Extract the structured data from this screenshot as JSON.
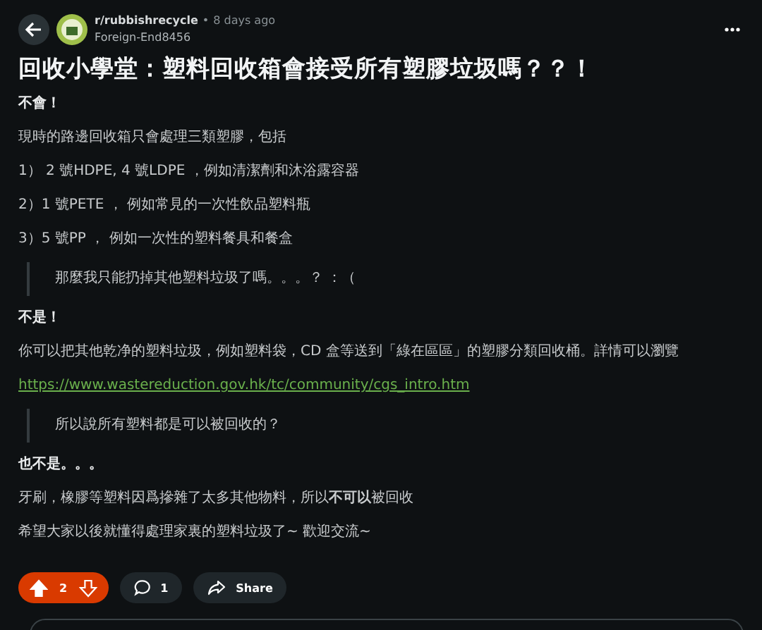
{
  "post": {
    "subreddit": "r/rubbishrecycle",
    "separator": "•",
    "time": "8 days ago",
    "author": "Foreign-End8456",
    "title": "回收小學堂：塑料回收箱會接受所有塑膠垃圾嗎？？！"
  },
  "body": [
    {
      "kind": "bold",
      "text": "不會！"
    },
    {
      "kind": "text",
      "text": "現時的路邊回收箱只會處理三類塑膠，包括"
    },
    {
      "kind": "text",
      "text": "1） 2 號HDPE, 4 號LDPE ，例如清潔劑和沐浴露容器"
    },
    {
      "kind": "text",
      "text": "2）1 號PETE ， 例如常見的一次性飲品塑料瓶"
    },
    {
      "kind": "text",
      "text": "3）5 號PP ， 例如一次性的塑料餐具和餐盒"
    },
    {
      "kind": "quote",
      "text": "那麼我只能扔掉其他塑料垃圾了嗎。。。？ ：（"
    },
    {
      "kind": "bold",
      "text": "不是！"
    },
    {
      "kind": "text",
      "text": "你可以把其他乾净的塑料垃圾，例如塑料袋，CD 盒等送到「綠在區區」的塑膠分類回收桶。詳情可以瀏覽"
    },
    {
      "kind": "link",
      "text": "https://www.wastereduction.gov.hk/tc/community/cgs_intro.htm"
    },
    {
      "kind": "quote",
      "text": "所以說所有塑料都是可以被回收的？"
    },
    {
      "kind": "bold",
      "text": "也不是。。。"
    },
    {
      "kind": "text",
      "text": "牙刷，橡膠等塑料因爲摻雜了太多其他物料，所以**不可以**被回收"
    },
    {
      "kind": "text",
      "text": "希望大家以後就懂得處理家裏的塑料垃圾了~ 歡迎交流~"
    }
  ],
  "actions": {
    "votes": "2",
    "upvoted": true,
    "comments": "1",
    "share": "Share"
  }
}
